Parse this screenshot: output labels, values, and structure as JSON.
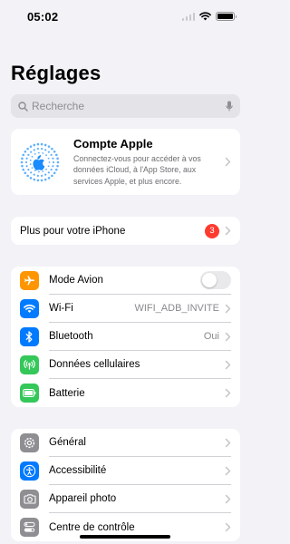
{
  "status": {
    "time": "05:02"
  },
  "header": {
    "title": "Réglages"
  },
  "search": {
    "placeholder": "Recherche",
    "icon": "search-icon",
    "mic_icon": "mic-icon"
  },
  "account": {
    "title": "Compte Apple",
    "description": "Connectez-vous pour accéder à vos données iCloud, à l'App Store, aux services Apple, et plus encore."
  },
  "plus": {
    "label": "Plus pour votre iPhone",
    "badge": "3"
  },
  "connectivity": [
    {
      "label": "Mode Avion",
      "icon": "airplane-icon",
      "color": "#ff9500",
      "toggle": false
    },
    {
      "label": "Wi-Fi",
      "icon": "wifi-icon",
      "color": "#007aff",
      "value": "WIFI_ADB_INVITE"
    },
    {
      "label": "Bluetooth",
      "icon": "bluetooth-icon",
      "color": "#007aff",
      "value": "Oui"
    },
    {
      "label": "Données cellulaires",
      "icon": "cellular-icon",
      "color": "#34c759"
    },
    {
      "label": "Batterie",
      "icon": "battery-icon",
      "color": "#34c759"
    }
  ],
  "system": [
    {
      "label": "Général",
      "icon": "gear-icon",
      "color": "#8e8e93"
    },
    {
      "label": "Accessibilité",
      "icon": "accessibility-icon",
      "color": "#007aff"
    },
    {
      "label": "Appareil photo",
      "icon": "camera-icon",
      "color": "#8e8e93"
    },
    {
      "label": "Centre de contrôle",
      "icon": "control-center-icon",
      "color": "#8e8e93"
    }
  ]
}
